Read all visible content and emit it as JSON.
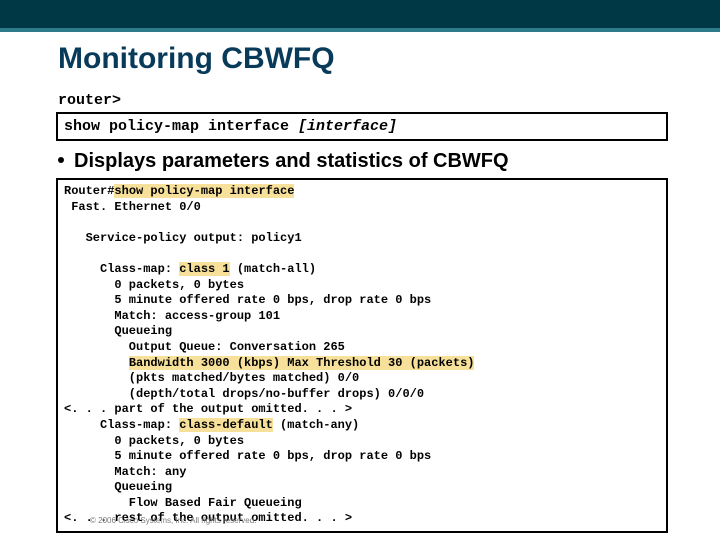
{
  "title": "Monitoring CBWFQ",
  "prompt": "router>",
  "command": {
    "cmd": "show policy-map interface ",
    "arg": "[interface]"
  },
  "bullet": "Displays parameters and statistics of CBWFQ",
  "out": {
    "l1a": "Router#",
    "l1b": "show policy-map interface",
    "l2": " Fast. Ethernet 0/0",
    "l3": "   Service-policy output: policy1",
    "l4a": "     Class-map: ",
    "l4b": "class 1",
    "l4c": " (match-all)",
    "l5": "       0 packets, 0 bytes",
    "l6": "       5 minute offered rate 0 bps, drop rate 0 bps",
    "l7": "       Match: access-group 101",
    "l8": "       Queueing",
    "l9": "         Output Queue: Conversation 265",
    "l10a": "         ",
    "l10b": "Bandwidth 3000 (kbps) Max Threshold 30 (packets)",
    "l11": "         (pkts matched/bytes matched) 0/0",
    "l12": "         (depth/total drops/no-buffer drops) 0/0/0",
    "l13": "<. . . part of the output omitted. . . >",
    "l14a": "     Class-map: ",
    "l14b": "class-default",
    "l14c": " (match-any)",
    "l15": "       0 packets, 0 bytes",
    "l16": "       5 minute offered rate 0 bps, drop rate 0 bps",
    "l17": "       Match: any",
    "l18": "       Queueing",
    "l19": "         Flow Based Fair Queueing",
    "l20": "<. . . rest of the output omitted. . . >"
  },
  "footer": "© 2006 Cisco Systems, Inc. All rights reserved."
}
